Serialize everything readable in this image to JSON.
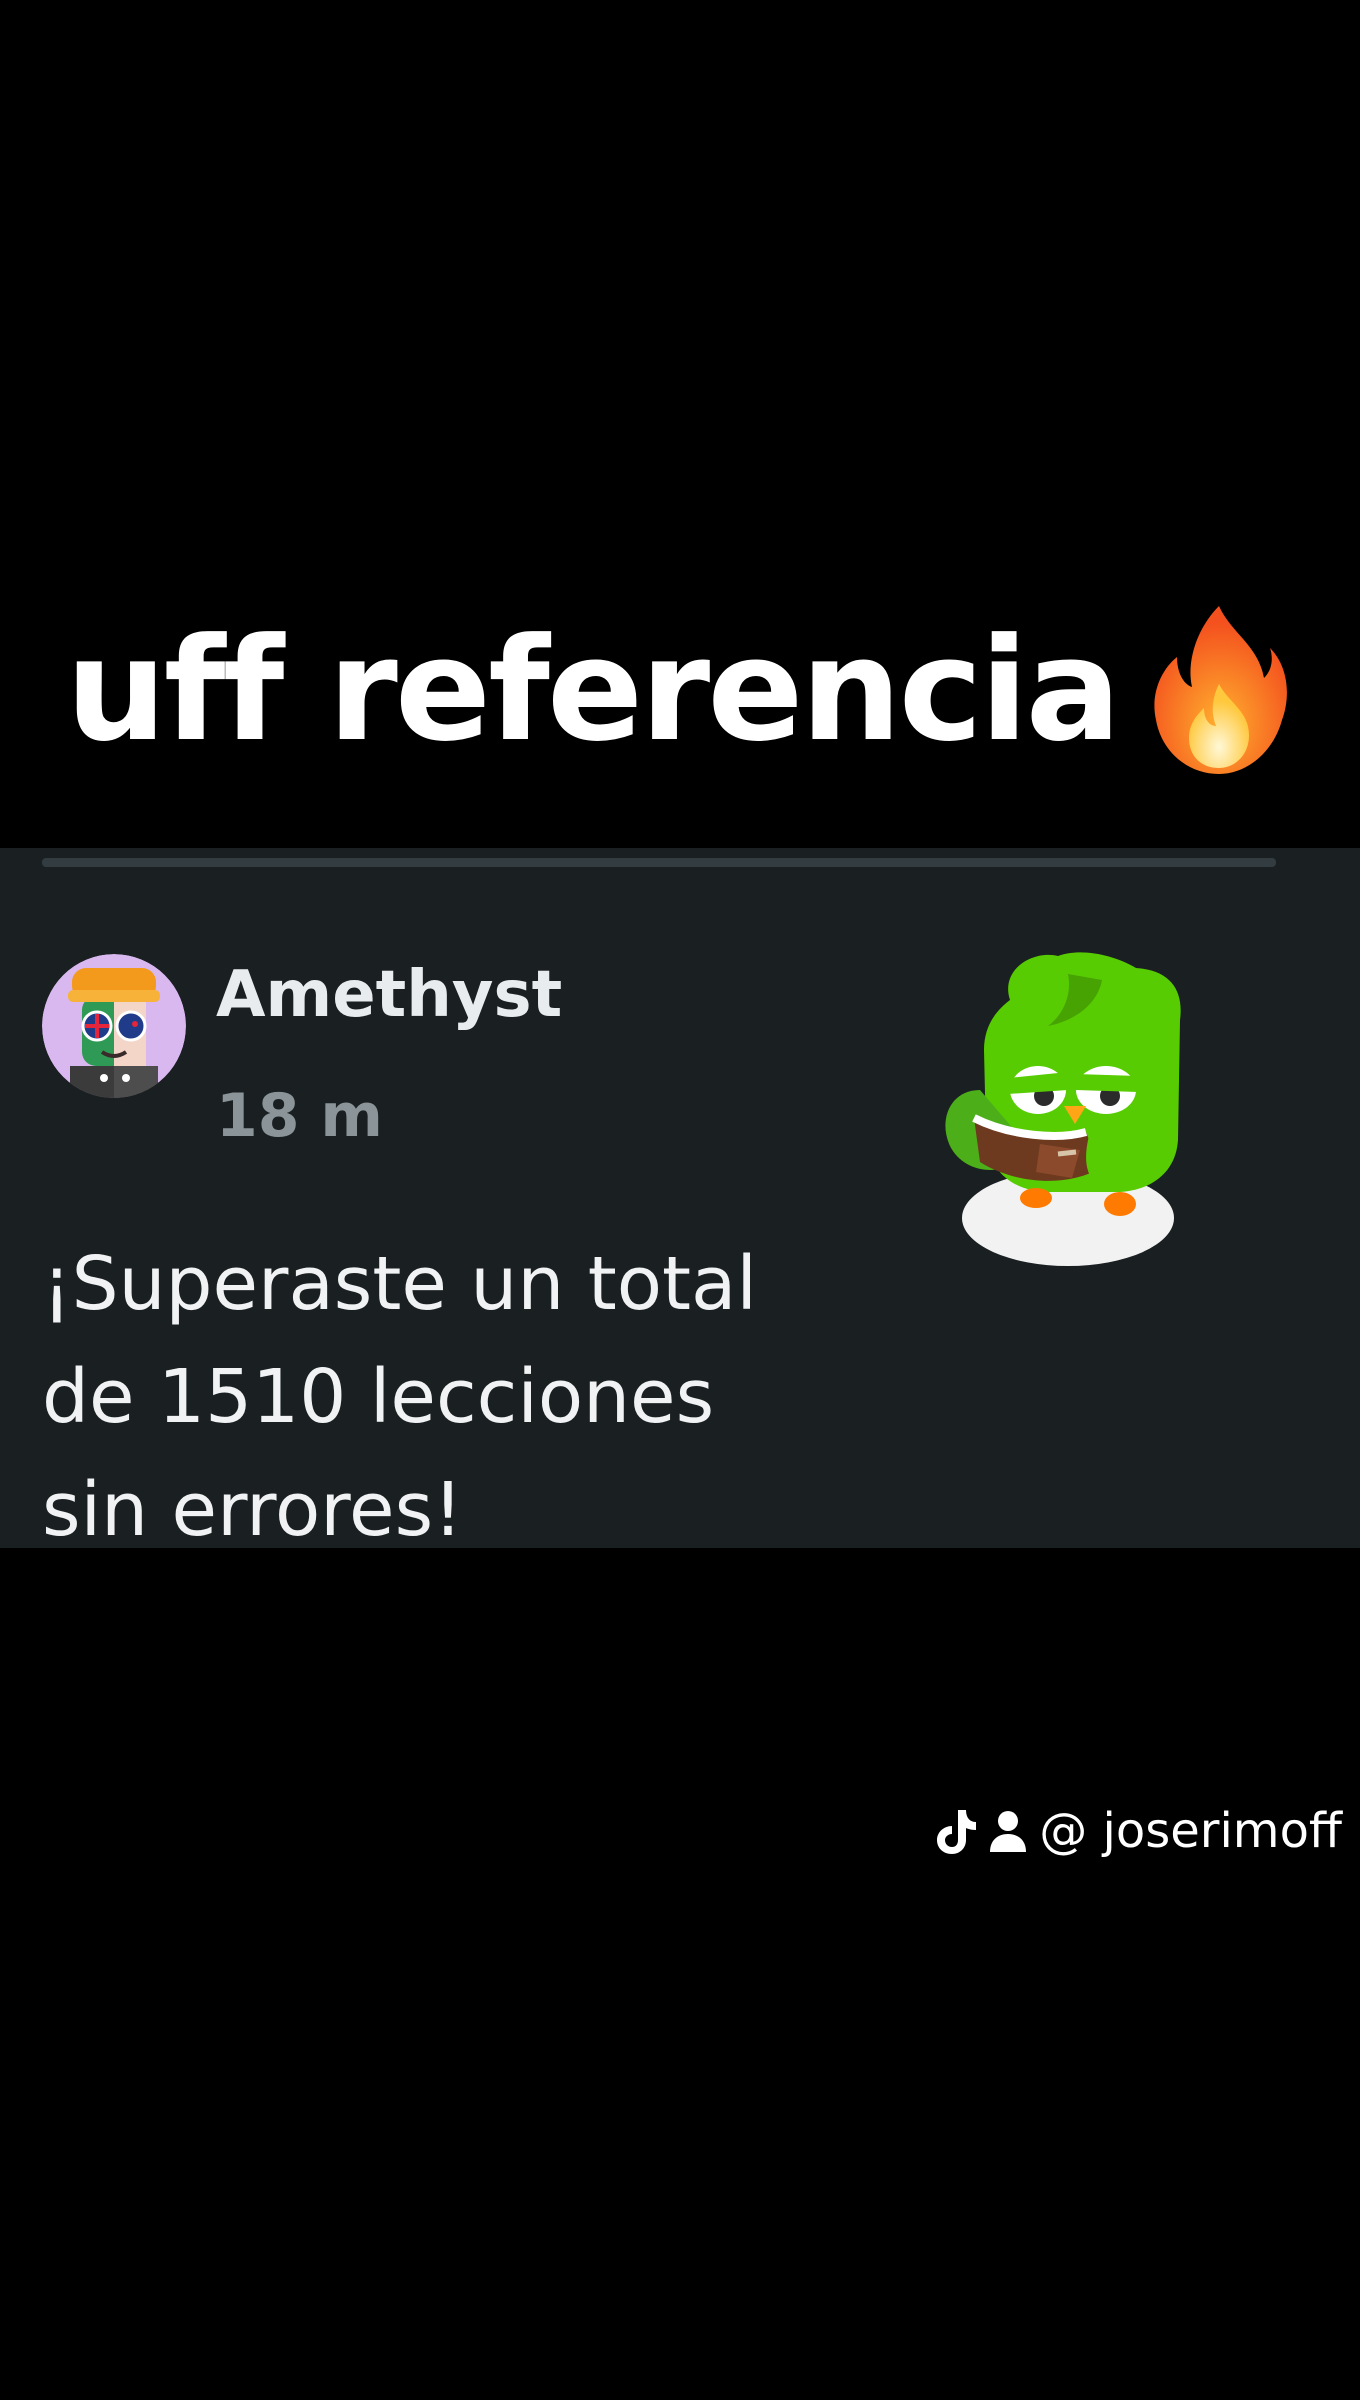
{
  "caption": {
    "text": "uff referencia",
    "emoji_icon": "fire-icon"
  },
  "post": {
    "author": "Amethyst",
    "time": "18 m",
    "message": "¡Superaste un total de 1510 lecciones sin errores!",
    "avatar_icon": "avatar",
    "mascot_icon": "duo-owl-icon"
  },
  "watermark": {
    "handle": "@ joserimoff",
    "icons": [
      "tiktok-icon",
      "user-icon"
    ]
  },
  "colors": {
    "background": "#000000",
    "card": "#1a1f22",
    "divider": "#333c40",
    "author": "#e8ecee",
    "time": "#8a9499",
    "owl_green": "#58cc02",
    "fire": "#ff7a1a"
  }
}
